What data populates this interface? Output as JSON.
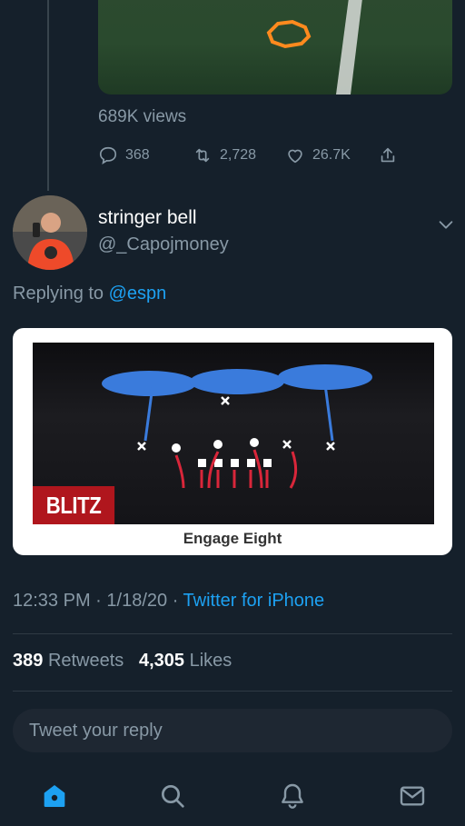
{
  "previous_tweet": {
    "views_text": "689K views",
    "replies": "368",
    "retweets": "2,728",
    "likes": "26.7K"
  },
  "tweet": {
    "display_name": "stringer bell",
    "handle": "@_Capojmoney",
    "replying_prefix": "Replying to",
    "replying_to": "@espn",
    "image": {
      "badge": "BLITZ",
      "caption": "Engage Eight"
    },
    "time": "12:33 PM",
    "date": "1/18/20",
    "source": "Twitter for iPhone",
    "retweets_count": "389",
    "retweets_label": "Retweets",
    "likes_count": "4,305",
    "likes_label": "Likes"
  },
  "reply": {
    "placeholder": "Tweet your reply"
  },
  "nav": {
    "icons": [
      "home-icon",
      "search-icon",
      "notifications-icon",
      "messages-icon"
    ],
    "active": "home-icon"
  },
  "colors": {
    "background": "#15202b",
    "accent": "#1da1f2",
    "muted": "#8899a6"
  }
}
